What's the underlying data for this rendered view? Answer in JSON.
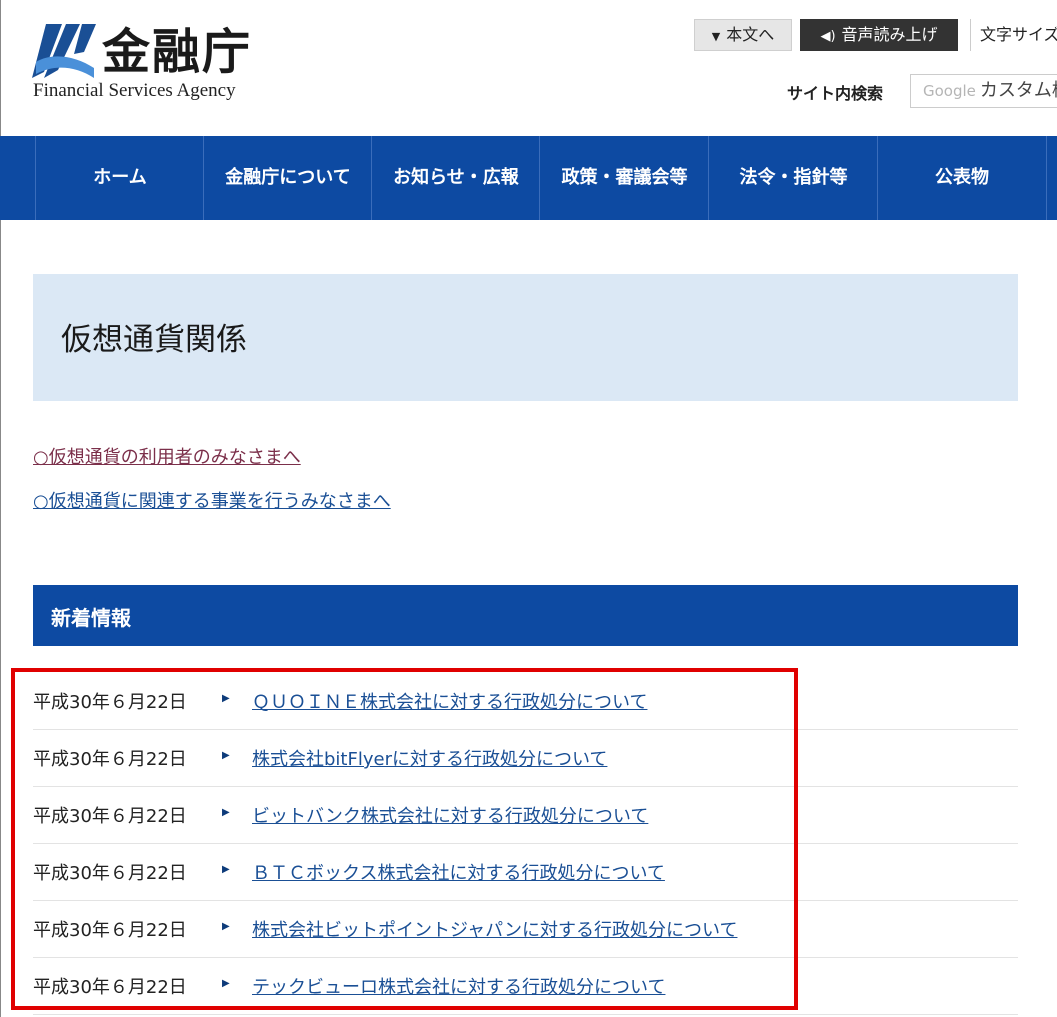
{
  "header": {
    "logo_jp": "金融庁",
    "logo_en": "Financial Services Agency",
    "skip_label": "本文へ",
    "voice_label": "音声読み上げ",
    "font_size_label": "文字サイズ",
    "search_label": "サイト内検索",
    "search_brand": "Google",
    "search_placeholder": "カスタム検索"
  },
  "nav": {
    "items": [
      {
        "label": "ホーム"
      },
      {
        "label": "金融庁について"
      },
      {
        "label": "お知らせ・広報"
      },
      {
        "label": "政策・審議会等"
      },
      {
        "label": "法令・指針等"
      },
      {
        "label": "公表物"
      }
    ]
  },
  "main": {
    "title": "仮想通貨関係",
    "links": [
      {
        "label": "○仮想通貨の利用者のみなさまへ"
      },
      {
        "label": "○仮想通貨に関連する事業を行うみなさまへ"
      }
    ],
    "news_heading": "新着情報",
    "news": [
      {
        "date": "平成30年６月22日",
        "title": "ＱＵＯＩＮＥ株式会社に対する行政処分について"
      },
      {
        "date": "平成30年６月22日",
        "title": "株式会社bitFlyerに対する行政処分について"
      },
      {
        "date": "平成30年６月22日",
        "title": "ビットバンク株式会社に対する行政処分について"
      },
      {
        "date": "平成30年６月22日",
        "title": "ＢＴＣボックス株式会社に対する行政処分について"
      },
      {
        "date": "平成30年６月22日",
        "title": "株式会社ビットポイントジャパンに対する行政処分について"
      },
      {
        "date": "平成30年６月22日",
        "title": "テックビューロ株式会社に対する行政処分について"
      }
    ]
  },
  "colors": {
    "nav_blue": "#0d4aa2",
    "title_bg": "#dbe8f5",
    "link_blue": "#1a4f95",
    "visited_link": "#7b2f4a",
    "highlight_red": "#e00000"
  }
}
